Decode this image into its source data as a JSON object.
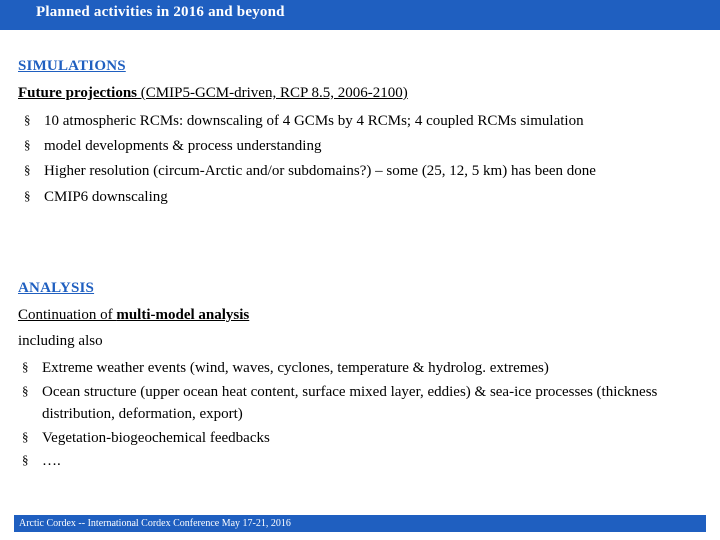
{
  "header": {
    "title": "Planned activities in  2016 and beyond",
    "bar_color": "#1f5fc0"
  },
  "simulations": {
    "section_title": "SIMULATIONS",
    "subhead_bold": "Future projections",
    "subhead_rest": " (CMIP5-GCM-driven, RCP 8.5, 2006-2100)",
    "bullet_marker": "§",
    "bullets": [
      "10 atmospheric RCMs: downscaling of 4 GCMs by 4 RCMs; 4 coupled RCMs simulation",
      "model developments & process understanding",
      "Higher resolution (circum-Arctic and/or subdomains?) – some (25, 12, 5 km) has been done",
      "CMIP6 downscaling"
    ]
  },
  "analysis": {
    "section_title": "ANALYSIS",
    "subhead_plain": "Continuation of ",
    "subhead_bold": "multi-model analysis",
    "including_text": "including also",
    "bullet_marker": "§",
    "bullets": [
      "Extreme weather events (wind, waves, cyclones, temperature & hydrolog. extremes)",
      "Ocean structure (upper ocean heat content, surface mixed layer, eddies) & sea-ice processes (thickness distribution, deformation, export)",
      "Vegetation-biogeochemical feedbacks",
      "…."
    ]
  },
  "footer": {
    "text": "Arctic Cordex --  International Cordex Conference  May 17-21, 2016",
    "bar_color": "#1f5fc0"
  }
}
